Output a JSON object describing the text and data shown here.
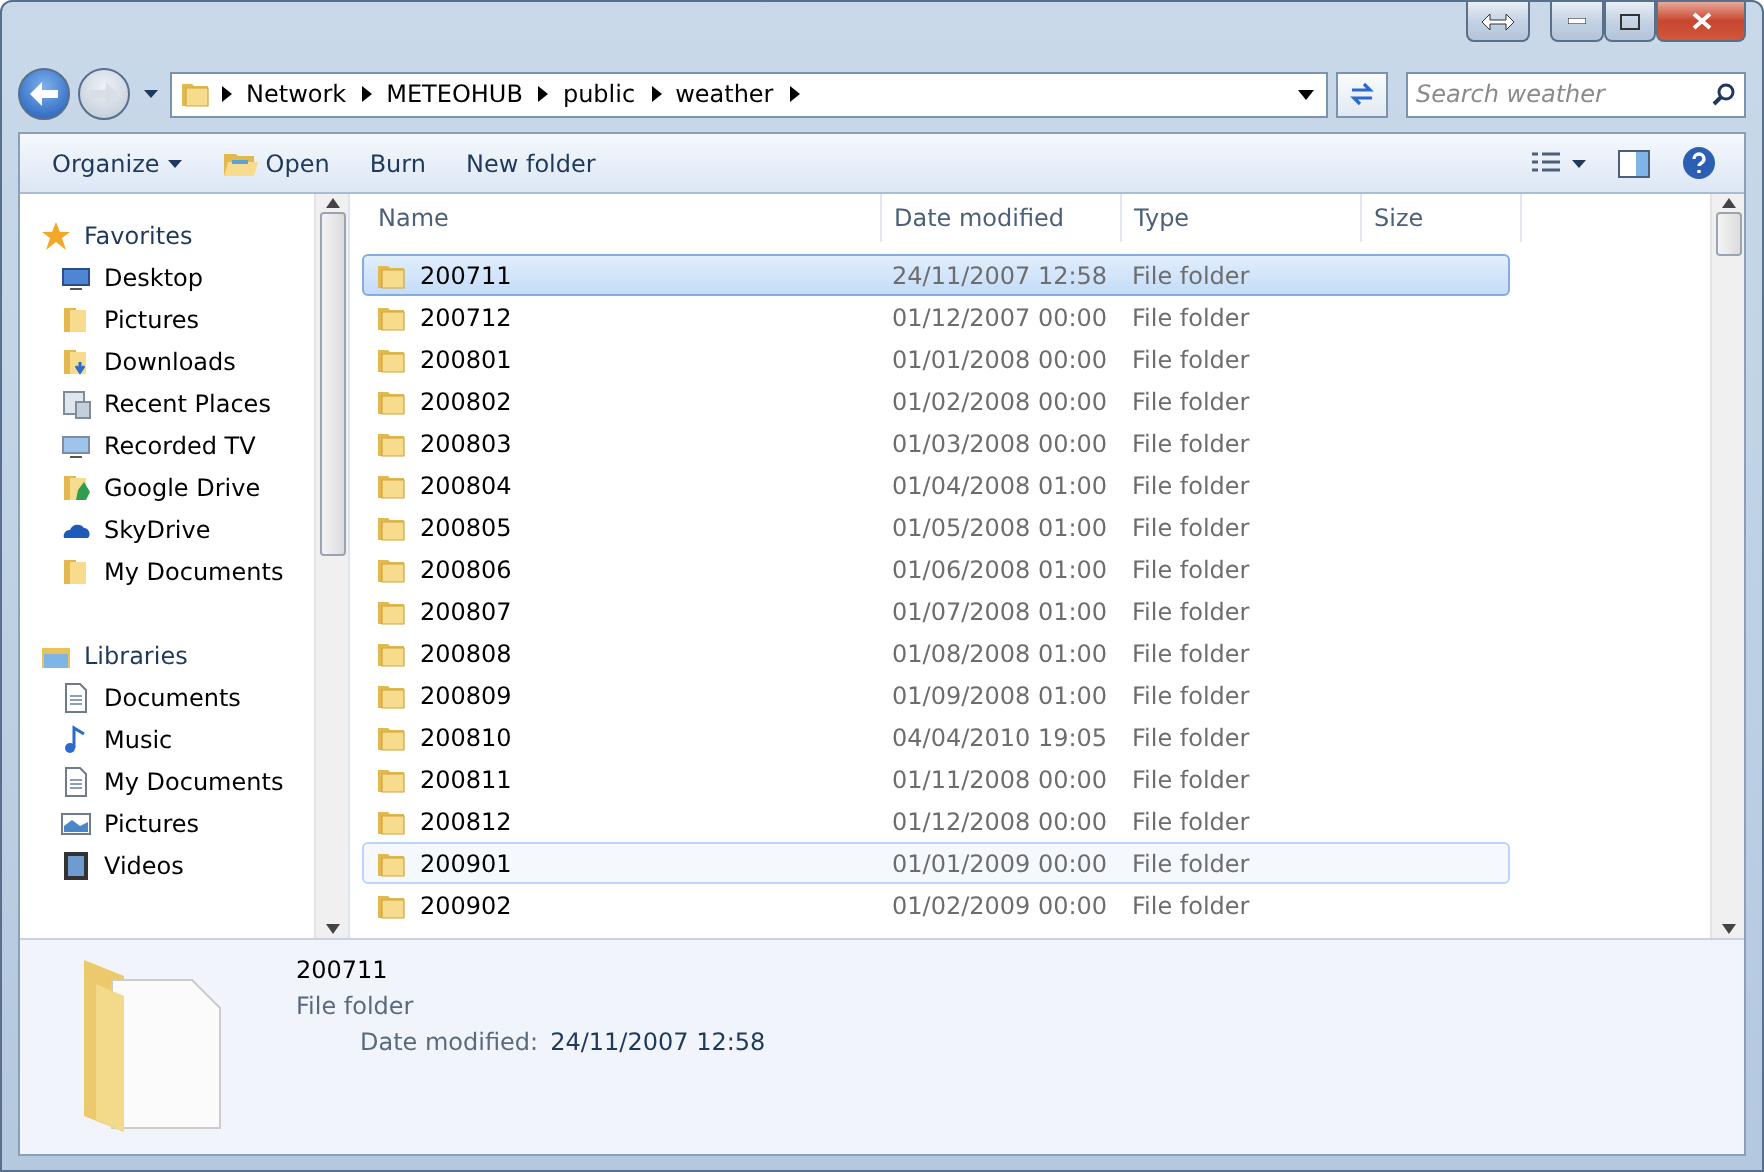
{
  "address": {
    "crumbs": [
      "Network",
      "METEOHUB",
      "public",
      "weather"
    ]
  },
  "search": {
    "placeholder": "Search weather"
  },
  "toolbar": {
    "buttons": [
      {
        "label": "Organize",
        "kind": "menu"
      },
      {
        "label": "Open",
        "kind": "open"
      },
      {
        "label": "Burn",
        "kind": "plain"
      },
      {
        "label": "New folder",
        "kind": "plain"
      }
    ]
  },
  "sidebar": {
    "sections": [
      {
        "label": "Favorites",
        "kind": "star",
        "items": [
          {
            "label": "Desktop",
            "kind": "desktop"
          },
          {
            "label": "Pictures",
            "kind": "folder"
          },
          {
            "label": "Downloads",
            "kind": "downloads"
          },
          {
            "label": "Recent Places",
            "kind": "recent"
          },
          {
            "label": "Recorded TV",
            "kind": "tv"
          },
          {
            "label": "Google Drive",
            "kind": "gdrive"
          },
          {
            "label": "SkyDrive",
            "kind": "cloud"
          },
          {
            "label": "My Documents",
            "kind": "folder"
          }
        ]
      },
      {
        "label": "Libraries",
        "kind": "library",
        "items": [
          {
            "label": "Documents",
            "kind": "document"
          },
          {
            "label": "Music",
            "kind": "music"
          },
          {
            "label": "My Documents",
            "kind": "document"
          },
          {
            "label": "Pictures",
            "kind": "picture"
          },
          {
            "label": "Videos",
            "kind": "video"
          }
        ]
      }
    ]
  },
  "table": {
    "columns": [
      "Name",
      "Date modified",
      "Type",
      "Size"
    ],
    "rows": [
      {
        "name": "200711",
        "date": "24/11/2007 12:58",
        "type": "File folder",
        "selected": true,
        "hovered": false
      },
      {
        "name": "200712",
        "date": "01/12/2007 00:00",
        "type": "File folder",
        "selected": false,
        "hovered": false
      },
      {
        "name": "200801",
        "date": "01/01/2008 00:00",
        "type": "File folder",
        "selected": false,
        "hovered": false
      },
      {
        "name": "200802",
        "date": "01/02/2008 00:00",
        "type": "File folder",
        "selected": false,
        "hovered": false
      },
      {
        "name": "200803",
        "date": "01/03/2008 00:00",
        "type": "File folder",
        "selected": false,
        "hovered": false
      },
      {
        "name": "200804",
        "date": "01/04/2008 01:00",
        "type": "File folder",
        "selected": false,
        "hovered": false
      },
      {
        "name": "200805",
        "date": "01/05/2008 01:00",
        "type": "File folder",
        "selected": false,
        "hovered": false
      },
      {
        "name": "200806",
        "date": "01/06/2008 01:00",
        "type": "File folder",
        "selected": false,
        "hovered": false
      },
      {
        "name": "200807",
        "date": "01/07/2008 01:00",
        "type": "File folder",
        "selected": false,
        "hovered": false
      },
      {
        "name": "200808",
        "date": "01/08/2008 01:00",
        "type": "File folder",
        "selected": false,
        "hovered": false
      },
      {
        "name": "200809",
        "date": "01/09/2008 01:00",
        "type": "File folder",
        "selected": false,
        "hovered": false
      },
      {
        "name": "200810",
        "date": "04/04/2010 19:05",
        "type": "File folder",
        "selected": false,
        "hovered": false
      },
      {
        "name": "200811",
        "date": "01/11/2008 00:00",
        "type": "File folder",
        "selected": false,
        "hovered": false
      },
      {
        "name": "200812",
        "date": "01/12/2008 00:00",
        "type": "File folder",
        "selected": false,
        "hovered": false
      },
      {
        "name": "200901",
        "date": "01/01/2009 00:00",
        "type": "File folder",
        "selected": false,
        "hovered": true
      },
      {
        "name": "200902",
        "date": "01/02/2009 00:00",
        "type": "File folder",
        "selected": false,
        "hovered": false
      }
    ]
  },
  "details": {
    "name": "200711",
    "type": "File folder",
    "field_label": "Date modified:",
    "field_value": "24/11/2007 12:58"
  }
}
